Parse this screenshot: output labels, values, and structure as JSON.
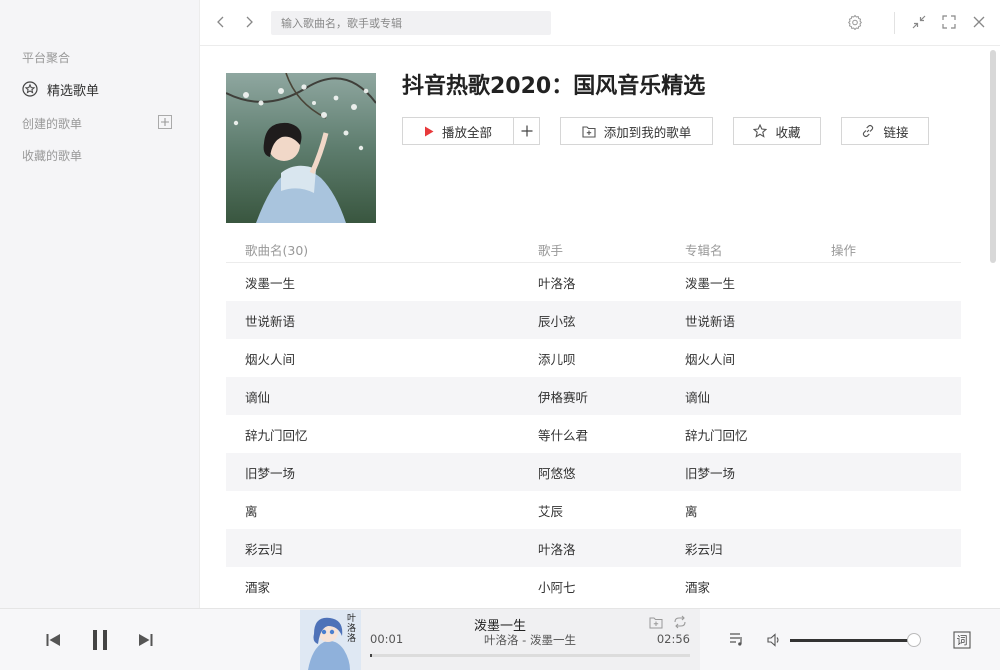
{
  "sidebar": {
    "platform_section": "平台聚合",
    "featured_item": "精选歌单",
    "created_section": "创建的歌单",
    "favorites_section": "收藏的歌单"
  },
  "topbar": {
    "search_placeholder": "输入歌曲名，歌手或专辑"
  },
  "playlist": {
    "title": "抖音热歌2020：国风音乐精选",
    "play_all": "播放全部",
    "add_to_mine": "添加到我的歌单",
    "favorite": "收藏",
    "link": "链接"
  },
  "table": {
    "headers": {
      "title": "歌曲名(30)",
      "artist": "歌手",
      "album": "专辑名",
      "ops": "操作"
    },
    "rows": [
      {
        "title": "泼墨一生",
        "artist": "叶洛洛",
        "album": "泼墨一生"
      },
      {
        "title": "世说新语",
        "artist": "辰小弦",
        "album": "世说新语"
      },
      {
        "title": "烟火人间",
        "artist": "添儿呗",
        "album": "烟火人间"
      },
      {
        "title": "谪仙",
        "artist": "伊格赛听",
        "album": "谪仙"
      },
      {
        "title": "辞九门回忆",
        "artist": "等什么君",
        "album": "辞九门回忆"
      },
      {
        "title": "旧梦一场",
        "artist": "阿悠悠",
        "album": "旧梦一场"
      },
      {
        "title": "离",
        "artist": "艾辰",
        "album": "离"
      },
      {
        "title": "彩云归",
        "artist": "叶洛洛",
        "album": "彩云归"
      },
      {
        "title": "酒家",
        "artist": "小阿七",
        "album": "酒家"
      }
    ]
  },
  "player": {
    "title": "泼墨一生",
    "subtitle": "叶洛洛 - 泼墨一生",
    "current_time": "00:01",
    "total_time": "02:56",
    "progress": 0.006,
    "volume": 0.95,
    "lyrics_label": "词",
    "cover_text": "叶洛洛"
  },
  "colors": {
    "accent_red": "#e8393b",
    "sidebar_bg": "#f5f5f7",
    "row_alt_bg": "#f5f5f7"
  }
}
